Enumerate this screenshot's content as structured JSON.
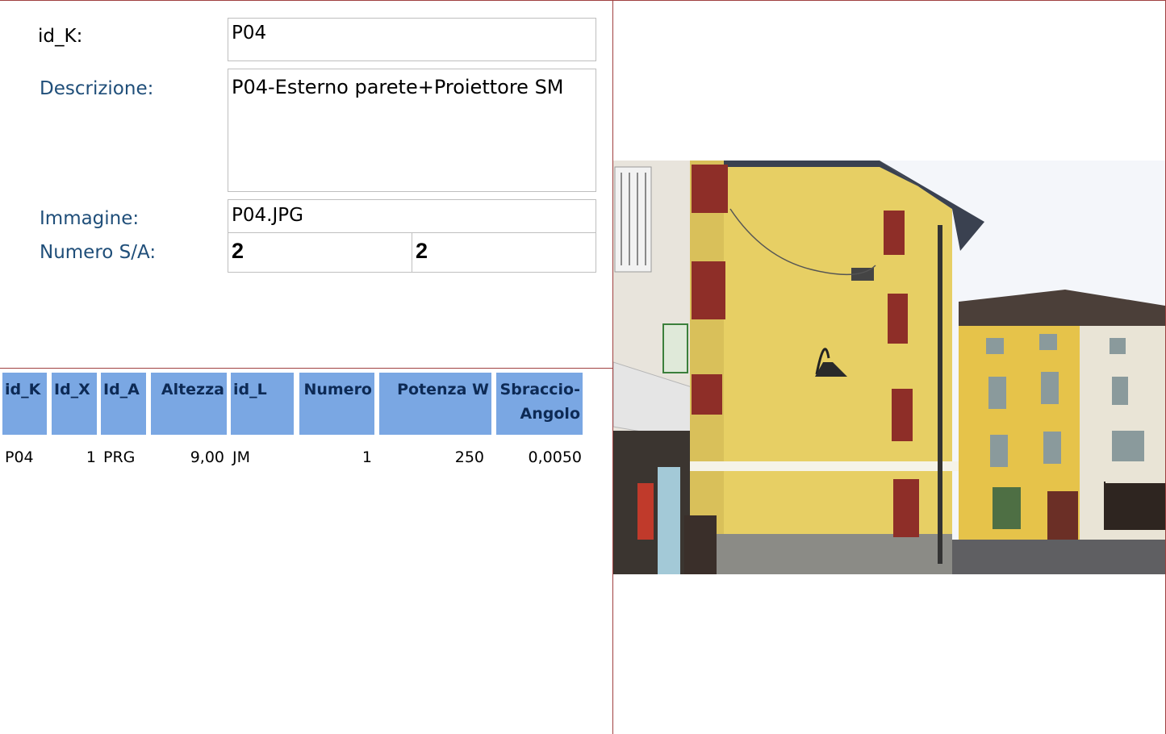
{
  "form": {
    "id_k_label": "id_K:",
    "id_k_value": "P04",
    "descrizione_label": "Descrizione:",
    "descrizione_value": "P04-Esterno parete+Proiettore SM",
    "immagine_label": "Immagine:",
    "immagine_value": "P04.JPG",
    "numero_label": "Numero S/A:",
    "numero_s": "2",
    "numero_a": "2"
  },
  "table": {
    "headers": [
      "id_K",
      "Id_X",
      "Id_A",
      "Altezza",
      "id_L",
      "Numero",
      "Potenza W",
      "Sbraccio-Angolo"
    ],
    "rows": [
      [
        "P04",
        "1",
        "PRG",
        "9,00",
        "JM",
        "1",
        "250",
        "0,0050"
      ]
    ]
  },
  "colors": {
    "label_blue": "#1f4e79",
    "header_bg": "#7aa7e3",
    "frame_red": "#a04040"
  }
}
